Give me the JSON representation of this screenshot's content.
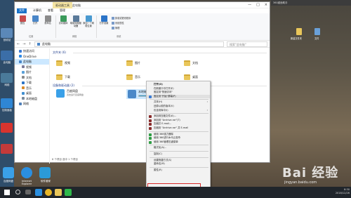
{
  "window": {
    "context_tab": "驱动器工具",
    "title": "此电脑",
    "controls": [
      "—",
      "□",
      "×"
    ],
    "menu_tabs": [
      "文件",
      "计算机",
      "查看",
      "管理"
    ],
    "ribbon": {
      "buttons": [
        "属性",
        "打开",
        "重命名",
        "访问媒体",
        "映射网络驱动器",
        "添加一个网络位置",
        "打开设置"
      ],
      "small": [
        "卸载或更改程序",
        "系统属性",
        "管理"
      ],
      "groups": [
        "位置",
        "网络",
        "系统"
      ]
    },
    "address": {
      "nav": [
        "←",
        "→",
        "↑"
      ],
      "path": "此电脑",
      "search_placeholder": "搜索\"此电脑\""
    }
  },
  "nav": [
    {
      "label": "快速访问",
      "color": "#3a7bd5"
    },
    {
      "label": "OneDrive",
      "color": "#2e8ae6"
    },
    {
      "label": "此电脑",
      "color": "#4a86c8",
      "selected": true
    },
    {
      "label": "视频",
      "color": "#7a7a9a"
    },
    {
      "label": "图片",
      "color": "#5aa0d8"
    },
    {
      "label": "文档",
      "color": "#8a8a8a"
    },
    {
      "label": "下载",
      "color": "#2b74c8"
    },
    {
      "label": "音乐",
      "color": "#d98a2b"
    },
    {
      "label": "桌面",
      "color": "#3f8fd1"
    },
    {
      "label": "本地磁盘",
      "color": "#7a8a9a"
    },
    {
      "label": "网络",
      "color": "#4f7fb8"
    }
  ],
  "content": {
    "folders_header": "文件夹 (6)",
    "folders": [
      "视频",
      "图片",
      "文档",
      "下载",
      "音乐",
      "桌面"
    ],
    "drives_header": "设备和驱动器 (2)",
    "drives": [
      {
        "name": "百度网盘",
        "sub": "双击运行百度网盘",
        "color": "#3aa0e8",
        "fill": 0
      },
      {
        "name": "本地磁盘 (C:)",
        "sub": "",
        "color": "#4a88c8",
        "fill": 0.45
      }
    ],
    "status": "8 个项目   选中 1 个项目"
  },
  "context_menu": [
    {
      "label": "打开(O)",
      "bold": true
    },
    {
      "label": "在新窗口中打开(E)"
    },
    {
      "label": "固定到\"快速访问\""
    },
    {
      "label": "固定到\"开始\"屏幕(P)",
      "highlighted": true,
      "icon": "#3a7bd5"
    },
    {
      "sep": true
    },
    {
      "label": "共享(H)",
      "submenu": true
    },
    {
      "label": "还原以前的版本(V)"
    },
    {
      "label": "包含到库中(I)",
      "submenu": true
    },
    {
      "sep": true
    },
    {
      "label": "添加到压缩文件(A)...",
      "icon": "#8a2b2b"
    },
    {
      "label": "添加到 \"Archive.rar\"(T)",
      "icon": "#8a2b2b"
    },
    {
      "label": "压缩并 E-mail...",
      "icon": "#8a2b2b"
    },
    {
      "label": "压缩到 \"Archive.rar\" 并 E-mail",
      "icon": "#8a2b2b"
    },
    {
      "sep": true
    },
    {
      "label": "使用 360强力删除",
      "icon": "#2f9e44"
    },
    {
      "label": "使用 360进行木马云查杀",
      "icon": "#2f9e44"
    },
    {
      "label": "使用 360管理右键菜单",
      "icon": "#2f9e44"
    },
    {
      "sep": true
    },
    {
      "label": "格式化(A)..."
    },
    {
      "sep": true
    },
    {
      "label": "复制(C)"
    },
    {
      "sep": true
    },
    {
      "label": "创建快捷方式(S)"
    },
    {
      "label": "重命名(M)"
    },
    {
      "sep": true
    },
    {
      "label": "属性(R)",
      "boxed": true
    }
  ],
  "desktop": {
    "left_labels": [
      "回收站",
      "此电脑",
      "网络",
      "控制面板"
    ],
    "bottom_labels": [
      "百度网盘",
      "Internet Explorer",
      "软件管家"
    ],
    "right_bar": "360桌面助手",
    "right_labels": [
      "新建文件夹",
      "文件"
    ]
  },
  "taskbar": {
    "time": "8:30",
    "date": "2018/12/26"
  },
  "watermark": {
    "brand": "Bai 经验",
    "url": "jingyan.baidu.com"
  }
}
